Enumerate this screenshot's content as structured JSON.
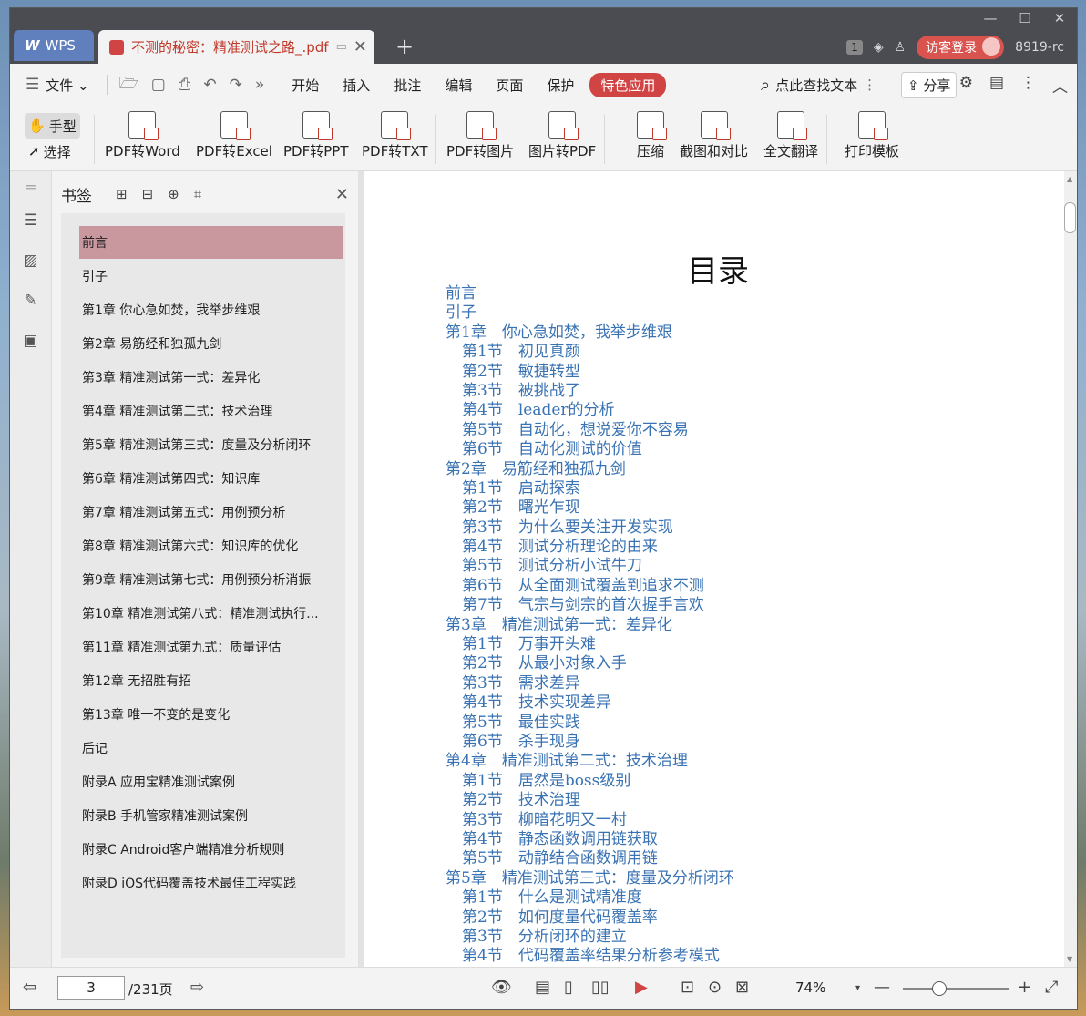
{
  "window_controls": {
    "minimize": "—",
    "maximize": "☐",
    "close": "✕"
  },
  "tabs": {
    "home_label": "WPS",
    "document_label": "不测的秘密：精准测试之路_.pdf",
    "new_tab": "+"
  },
  "titlebar_right": {
    "count_badge": "1",
    "login_label": "访客登录",
    "user_label": "8919-rc"
  },
  "menu": {
    "file_label": "文件",
    "items": [
      "开始",
      "插入",
      "批注",
      "编辑",
      "页面",
      "保护"
    ],
    "special_label": "特色应用",
    "search_label": "点此查找文本",
    "share_label": "分享"
  },
  "ribbon": {
    "hand_label": "手型",
    "select_label": "选择",
    "buttons": [
      "PDF转Word",
      "PDF转Excel",
      "PDF转PPT",
      "PDF转TXT",
      "PDF转图片",
      "图片转PDF",
      "压缩",
      "截图和对比",
      "全文翻译",
      "打印模板"
    ]
  },
  "bookmarks": {
    "title": "书签",
    "items": [
      {
        "label": "前言",
        "expandable": false,
        "selected": true
      },
      {
        "label": "引子",
        "expandable": false
      },
      {
        "label": "第1章 你心急如焚，我举步维艰",
        "expandable": true
      },
      {
        "label": "第2章 易筋经和独孤九剑",
        "expandable": true
      },
      {
        "label": "第3章 精准测试第一式：差异化",
        "expandable": true
      },
      {
        "label": "第4章 精准测试第二式：技术治理",
        "expandable": true
      },
      {
        "label": "第5章 精准测试第三式：度量及分析闭环",
        "expandable": true
      },
      {
        "label": "第6章 精准测试第四式：知识库",
        "expandable": true
      },
      {
        "label": "第7章 精准测试第五式：用例预分析",
        "expandable": true
      },
      {
        "label": "第8章 精准测试第六式：知识库的优化",
        "expandable": true
      },
      {
        "label": "第9章 精准测试第七式：用例预分析消振",
        "expandable": true
      },
      {
        "label": "第10章 精准测试第八式：精准测试执行...",
        "expandable": true
      },
      {
        "label": "第11章 精准测试第九式：质量评估",
        "expandable": true
      },
      {
        "label": "第12章 无招胜有招",
        "expandable": true
      },
      {
        "label": "第13章 唯一不变的是变化",
        "expandable": true
      },
      {
        "label": "后记",
        "expandable": false
      },
      {
        "label": "附录A 应用宝精准测试案例",
        "expandable": false
      },
      {
        "label": "附录B 手机管家精准测试案例",
        "expandable": false
      },
      {
        "label": "附录C Android客户端精准分析规则",
        "expandable": false
      },
      {
        "label": "附录D iOS代码覆盖技术最佳工程实践",
        "expandable": false
      }
    ]
  },
  "document": {
    "title": "目录",
    "toc": [
      {
        "text": "前言",
        "level": 1
      },
      {
        "text": "引子",
        "level": 1
      },
      {
        "text": "第1章　你心急如焚，我举步维艰",
        "level": 1
      },
      {
        "text": "第1节　初见真颜",
        "level": 2
      },
      {
        "text": "第2节　敏捷转型",
        "level": 2
      },
      {
        "text": "第3节　被挑战了",
        "level": 2
      },
      {
        "text": "第4节　leader的分析",
        "level": 2
      },
      {
        "text": "第5节　自动化，想说爱你不容易",
        "level": 2
      },
      {
        "text": "第6节　自动化测试的价值",
        "level": 2
      },
      {
        "text": "第2章　易筋经和独孤九剑",
        "level": 1
      },
      {
        "text": "第1节　启动探索",
        "level": 2
      },
      {
        "text": "第2节　曙光乍现",
        "level": 2
      },
      {
        "text": "第3节　为什么要关注开发实现",
        "level": 2
      },
      {
        "text": "第4节　测试分析理论的由来",
        "level": 2
      },
      {
        "text": "第5节　测试分析小试牛刀",
        "level": 2
      },
      {
        "text": "第6节　从全面测试覆盖到追求不测",
        "level": 2
      },
      {
        "text": "第7节　气宗与剑宗的首次握手言欢",
        "level": 2
      },
      {
        "text": "第3章　精准测试第一式：差异化",
        "level": 1
      },
      {
        "text": "第1节　万事开头难",
        "level": 2
      },
      {
        "text": "第2节　从最小对象入手",
        "level": 2
      },
      {
        "text": "第3节　需求差异",
        "level": 2
      },
      {
        "text": "第4节　技术实现差异",
        "level": 2
      },
      {
        "text": "第5节　最佳实践",
        "level": 2
      },
      {
        "text": "第6节　杀手现身",
        "level": 2
      },
      {
        "text": "第4章　精准测试第二式：技术治理",
        "level": 1
      },
      {
        "text": "第1节　居然是boss级别",
        "level": 2
      },
      {
        "text": "第2节　技术治理",
        "level": 2
      },
      {
        "text": "第3节　柳暗花明又一村",
        "level": 2
      },
      {
        "text": "第4节　静态函数调用链获取",
        "level": 2
      },
      {
        "text": "第5节　动静结合函数调用链",
        "level": 2
      },
      {
        "text": "第5章　精准测试第三式：度量及分析闭环",
        "level": 1
      },
      {
        "text": "第1节　什么是测试精准度",
        "level": 2
      },
      {
        "text": "第2节　如何度量代码覆盖率",
        "level": 2
      },
      {
        "text": "第3节　分析闭环的建立",
        "level": 2
      },
      {
        "text": "第4节　代码覆盖率结果分析参考模式",
        "level": 2
      }
    ]
  },
  "statusbar": {
    "current_page": "3",
    "total_pages": "/231页",
    "zoom_label": "74%"
  },
  "colors": {
    "accent": "#d14444",
    "toc_link": "#3a73b3",
    "bookmark_selected": "#c9979e"
  }
}
